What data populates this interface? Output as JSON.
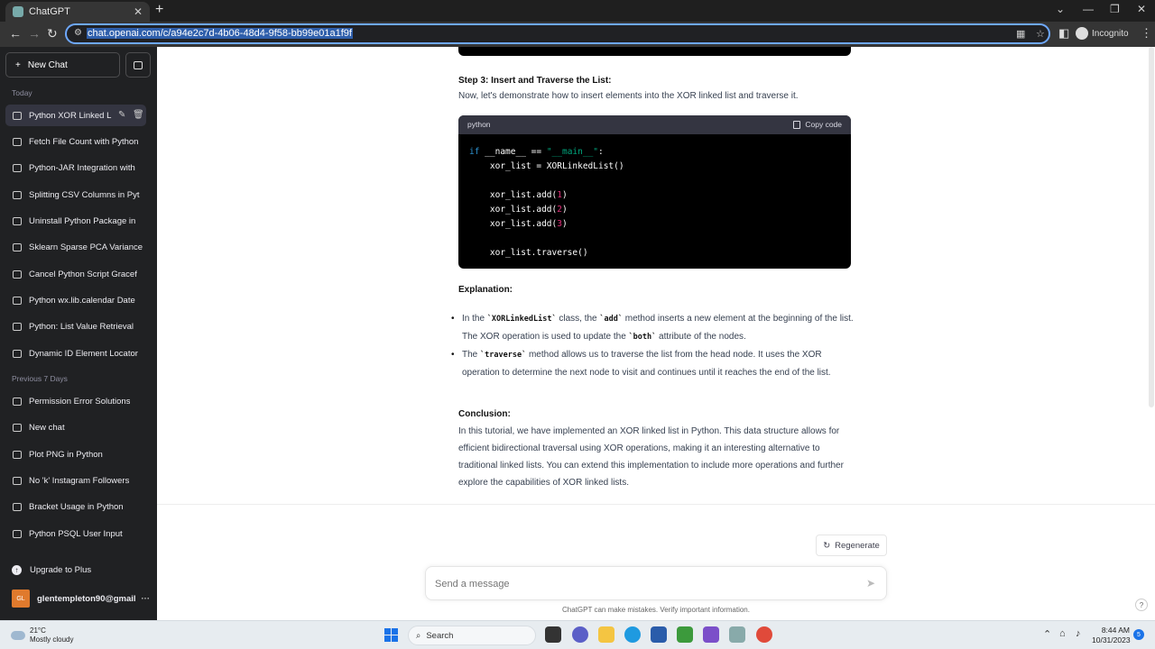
{
  "browser": {
    "tab_title": "ChatGPT",
    "tab_close": "✕",
    "new_tab": "+",
    "url": "chat.openai.com/c/a94e2c7d-4b06-48d4-9f58-bb99e01a1f9f",
    "incognito_label": "Incognito"
  },
  "sidebar": {
    "new_chat_label": "New Chat",
    "today_label": "Today",
    "today_items": [
      "Python XOR Linked Li",
      "Fetch File Count with Python",
      "Python-JAR Integration with",
      "Splitting CSV Columns in Pyt",
      "Uninstall Python Package in",
      "Sklearn Sparse PCA Variance",
      "Cancel Python Script Gracef",
      "Python wx.lib.calendar Date",
      "Python: List Value Retrieval",
      "Dynamic ID Element Locator"
    ],
    "prev7_label": "Previous 7 Days",
    "prev7_items": [
      "Permission Error Solutions",
      "New chat",
      "Plot PNG in Python",
      "No 'k' Instagram Followers",
      "Bracket Usage in Python",
      "Python PSQL User Input"
    ],
    "upgrade_label": "Upgrade to Plus",
    "user_initials": "GL",
    "user_email": "glentempleton90@gmail",
    "more": "···"
  },
  "content": {
    "step3_heading": "Step 3: Insert and Traverse the List:",
    "step3_text": "Now, let's demonstrate how to insert elements into the XOR linked list and traverse it.",
    "code_lang": "python",
    "copy_label": "Copy code",
    "explanation_heading": "Explanation:",
    "b1_pre": "In the ",
    "b1_code1": "`XORLinkedList`",
    "b1_mid1": " class, the ",
    "b1_code2": "`add`",
    "b1_mid2": " method inserts a new element at the beginning of the list. The XOR operation is used to update the ",
    "b1_code3": "`both`",
    "b1_post": " attribute of the nodes.",
    "b2_pre": "The ",
    "b2_code": "`traverse`",
    "b2_post": " method allows us to traverse the list from the head node. It uses the XOR operation to determine the next node to visit and continues until it reaches the end of the list.",
    "conclusion_heading": "Conclusion:",
    "conclusion_text": "In this tutorial, we have implemented an XOR linked list in Python. This data structure allows for efficient bidirectional traversal using XOR operations, making it an interesting alternative to traditional linked lists. You can extend this implementation to include more operations and further explore the capabilities of XOR linked lists."
  },
  "code": {
    "kw_if": "if",
    "t1": " __name__ == ",
    "s_main": "\"__main__\"",
    "t2": ":",
    "l2": "    xor_list = XORLinkedList()",
    "l4a": "    xor_list.add(",
    "n1": "1",
    "l5a": "    xor_list.add(",
    "n2": "2",
    "l6a": "    xor_list.add(",
    "n3": "3",
    "close": ")",
    "l8": "    xor_list.traverse()"
  },
  "composer": {
    "regenerate_label": "Regenerate",
    "placeholder": "Send a message",
    "disclaimer": "ChatGPT can make mistakes. Verify important information.",
    "help": "?"
  },
  "taskbar": {
    "temp": "21°C",
    "weather": "Mostly cloudy",
    "search_label": "Search",
    "time": "8:44 AM",
    "date": "10/31/2023",
    "notifications": "5"
  }
}
